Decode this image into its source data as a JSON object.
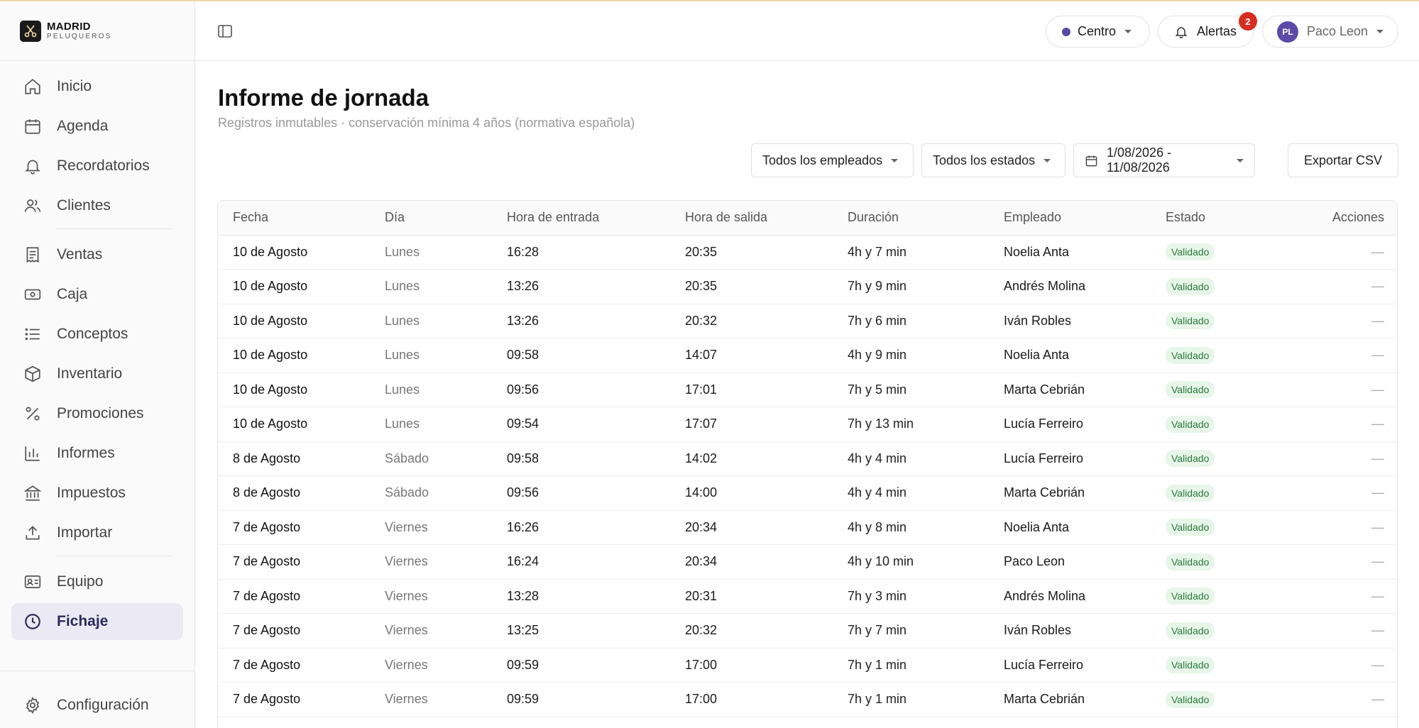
{
  "brand": {
    "title": "MADRID",
    "subtitle": "PELUQUEROS"
  },
  "sidebar": {
    "items": [
      {
        "label": "Inicio",
        "icon": "home-icon"
      },
      {
        "label": "Agenda",
        "icon": "calendar-icon"
      },
      {
        "label": "Recordatorios",
        "icon": "bell-icon"
      },
      {
        "label": "Clientes",
        "icon": "users-icon"
      },
      {
        "label": "Ventas",
        "icon": "receipt-icon"
      },
      {
        "label": "Caja",
        "icon": "cash-icon"
      },
      {
        "label": "Conceptos",
        "icon": "list-icon"
      },
      {
        "label": "Inventario",
        "icon": "box-icon"
      },
      {
        "label": "Promociones",
        "icon": "percent-icon"
      },
      {
        "label": "Informes",
        "icon": "bar-chart-icon"
      },
      {
        "label": "Impuestos",
        "icon": "bank-icon"
      },
      {
        "label": "Importar",
        "icon": "upload-icon"
      },
      {
        "label": "Equipo",
        "icon": "id-card-icon"
      },
      {
        "label": "Fichaje",
        "icon": "clock-icon",
        "active": true
      }
    ],
    "settings_label": "Configuración"
  },
  "topbar": {
    "location": "Centro",
    "alerts_label": "Alertas",
    "alerts_count": "2",
    "user_initials": "PL",
    "user_name": "Paco Leon"
  },
  "page": {
    "title": "Informe de jornada",
    "subtitle": "Registros inmutables · conservación mínima 4 años (normativa española)"
  },
  "filters": {
    "employees": "Todos los empleados",
    "states": "Todos los estados",
    "date_range": "1/08/2026 - 11/08/2026",
    "export": "Exportar CSV"
  },
  "colors": {
    "accent": "#5b4aa6",
    "badge": "#d92d20",
    "status_bg": "#e8f6ea",
    "status_text": "#2b7a3d"
  },
  "table": {
    "headers": [
      "Fecha",
      "Día",
      "Hora de entrada",
      "Hora de salida",
      "Duración",
      "Empleado",
      "Estado",
      "Acciones"
    ],
    "rows": [
      [
        "10 de Agosto",
        "Lunes",
        "16:28",
        "20:35",
        "4h y 7 min",
        "Noelia Anta",
        "Validado",
        "—"
      ],
      [
        "10 de Agosto",
        "Lunes",
        "13:26",
        "20:35",
        "7h y 9 min",
        "Andrés Molina",
        "Validado",
        "—"
      ],
      [
        "10 de Agosto",
        "Lunes",
        "13:26",
        "20:32",
        "7h y 6 min",
        "Iván Robles",
        "Validado",
        "—"
      ],
      [
        "10 de Agosto",
        "Lunes",
        "09:58",
        "14:07",
        "4h y 9 min",
        "Noelia Anta",
        "Validado",
        "—"
      ],
      [
        "10 de Agosto",
        "Lunes",
        "09:56",
        "17:01",
        "7h y 5 min",
        "Marta Cebrián",
        "Validado",
        "—"
      ],
      [
        "10 de Agosto",
        "Lunes",
        "09:54",
        "17:07",
        "7h y 13 min",
        "Lucía Ferreiro",
        "Validado",
        "—"
      ],
      [
        "8 de Agosto",
        "Sábado",
        "09:58",
        "14:02",
        "4h y 4 min",
        "Lucía Ferreiro",
        "Validado",
        "—"
      ],
      [
        "8 de Agosto",
        "Sábado",
        "09:56",
        "14:00",
        "4h y 4 min",
        "Marta Cebrián",
        "Validado",
        "—"
      ],
      [
        "7 de Agosto",
        "Viernes",
        "16:26",
        "20:34",
        "4h y 8 min",
        "Noelia Anta",
        "Validado",
        "—"
      ],
      [
        "7 de Agosto",
        "Viernes",
        "16:24",
        "20:34",
        "4h y 10 min",
        "Paco Leon",
        "Validado",
        "—"
      ],
      [
        "7 de Agosto",
        "Viernes",
        "13:28",
        "20:31",
        "7h y 3 min",
        "Andrés Molina",
        "Validado",
        "—"
      ],
      [
        "7 de Agosto",
        "Viernes",
        "13:25",
        "20:32",
        "7h y 7 min",
        "Iván Robles",
        "Validado",
        "—"
      ],
      [
        "7 de Agosto",
        "Viernes",
        "09:59",
        "17:00",
        "7h y 1 min",
        "Lucía Ferreiro",
        "Validado",
        "—"
      ],
      [
        "7 de Agosto",
        "Viernes",
        "09:59",
        "17:00",
        "7h y 1 min",
        "Marta Cebrián",
        "Validado",
        "—"
      ]
    ]
  }
}
